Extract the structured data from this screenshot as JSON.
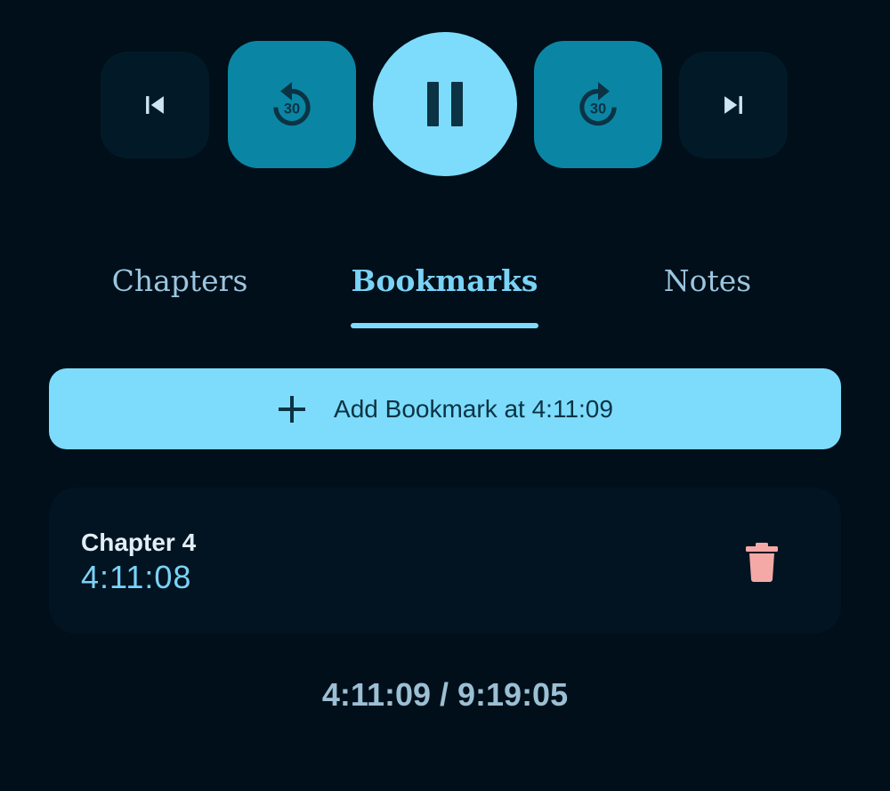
{
  "controls": {
    "previous": {
      "icon": "skip-previous-icon"
    },
    "rewind": {
      "icon": "replay-30-icon",
      "seconds_label": "30"
    },
    "play_pause": {
      "icon": "pause-icon",
      "state": "playing"
    },
    "forward": {
      "icon": "forward-30-icon",
      "seconds_label": "30"
    },
    "next": {
      "icon": "skip-next-icon"
    }
  },
  "tabs": [
    {
      "label": "Chapters",
      "active": false
    },
    {
      "label": "Bookmarks",
      "active": true
    },
    {
      "label": "Notes",
      "active": false
    }
  ],
  "add_bookmark": {
    "icon": "plus-icon",
    "label": "Add Bookmark at 4:11:09"
  },
  "bookmarks": [
    {
      "chapter": "Chapter 4",
      "time": "4:11:08",
      "delete_icon": "trash-icon"
    }
  ],
  "progress": {
    "text": "4:11:09 / 9:19:05",
    "elapsed": "4:11:09",
    "total": "9:19:05"
  },
  "colors": {
    "background": "#000f19",
    "accent": "#7ddcfb",
    "seek_button": "#0a86a4",
    "delete": "#f4a9a6"
  }
}
